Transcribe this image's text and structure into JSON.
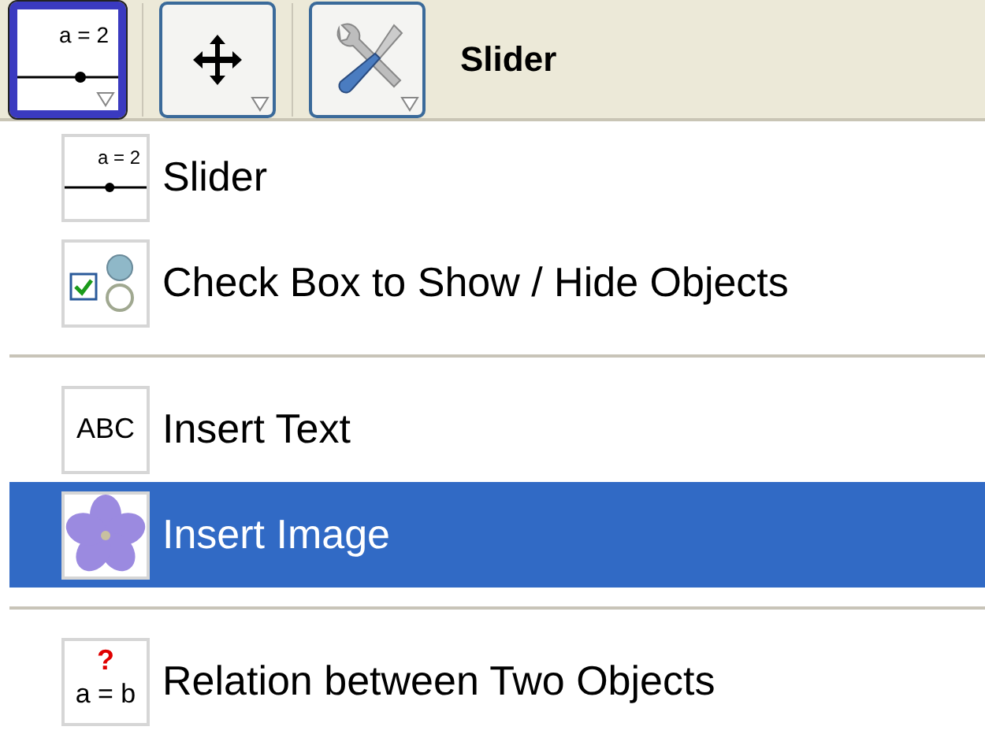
{
  "toolbar": {
    "buttons": [
      {
        "kind": "slider",
        "icon_text": "a = 2",
        "selected": true
      },
      {
        "kind": "move",
        "selected": false
      },
      {
        "kind": "tools",
        "selected": false
      }
    ],
    "tool_name": "Slider"
  },
  "menu": {
    "items": [
      {
        "kind": "slider",
        "icon_text": "a = 2",
        "label": "Slider",
        "selected": false
      },
      {
        "kind": "checkbox",
        "label": "Check Box to Show / Hide Objects",
        "selected": false
      },
      {
        "kind": "separator"
      },
      {
        "kind": "text",
        "icon_text": "ABC",
        "label": "Insert Text",
        "selected": false
      },
      {
        "kind": "image",
        "label": "Insert Image",
        "selected": true
      },
      {
        "kind": "separator"
      },
      {
        "kind": "relation",
        "icon_text": "a = b",
        "icon_mark": "?",
        "label": "Relation between Two Objects",
        "selected": false
      }
    ]
  }
}
